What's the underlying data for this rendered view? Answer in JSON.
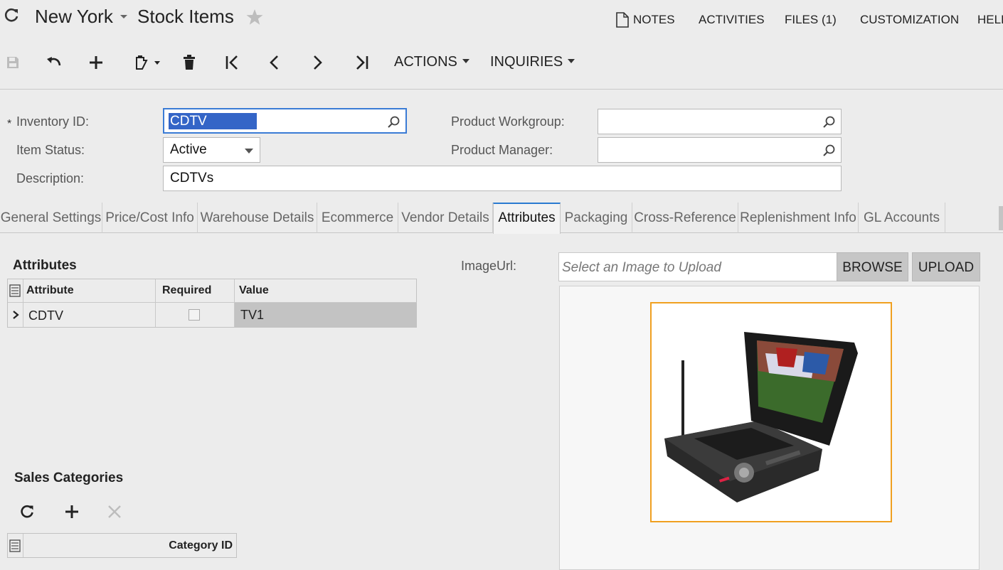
{
  "header": {
    "company": "New York",
    "screen_title": "Stock Items",
    "links": [
      "NOTES",
      "ACTIVITIES",
      "FILES (1)",
      "CUSTOMIZATION",
      "HELP"
    ]
  },
  "toolbar": {
    "actions_label": "ACTIONS",
    "inquiries_label": "INQUIRIES"
  },
  "form": {
    "inventory_id_label": "Inventory ID:",
    "inventory_id_value": "CDTV",
    "item_status_label": "Item Status:",
    "item_status_value": "Active",
    "description_label": "Description:",
    "description_value": "CDTVs",
    "product_workgroup_label": "Product Workgroup:",
    "product_workgroup_value": "",
    "product_manager_label": "Product Manager:",
    "product_manager_value": ""
  },
  "tabs": [
    {
      "label": "General Settings"
    },
    {
      "label": "Price/Cost Info"
    },
    {
      "label": "Warehouse Details"
    },
    {
      "label": "Ecommerce"
    },
    {
      "label": "Vendor Details"
    },
    {
      "label": "Attributes"
    },
    {
      "label": "Packaging"
    },
    {
      "label": "Cross-Reference"
    },
    {
      "label": "Replenishment Info"
    },
    {
      "label": "GL Accounts"
    }
  ],
  "active_tab": "Attributes",
  "attributes": {
    "title": "Attributes",
    "columns": [
      "Attribute",
      "Required",
      "Value"
    ],
    "rows": [
      {
        "attribute": "CDTV",
        "required": false,
        "value": "TV1"
      }
    ]
  },
  "image": {
    "label": "ImageUrl:",
    "placeholder": "Select an Image to Upload",
    "browse_label": "BROWSE",
    "upload_label": "UPLOAD"
  },
  "sales_categories": {
    "title": "Sales Categories",
    "columns": [
      "Category ID"
    ]
  },
  "colors": {
    "accent": "#2a7ad1",
    "selection": "#3465c7",
    "image_frame": "#f0a020"
  }
}
